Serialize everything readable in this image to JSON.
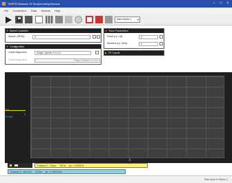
{
  "window": {
    "title": "TM/PS3 Balance Of Reciprocating Masses"
  },
  "menu": [
    "File",
    "Connection",
    "Data",
    "Options",
    "Help"
  ],
  "toolbar": {
    "dataset_select": "Data Series 1"
  },
  "speed_controller": {
    "title": "Speed Controller",
    "speed_label": "Speed: (RPM):",
    "speed_value": "0"
  },
  "configuration": {
    "title": "Configuration",
    "crank_label": "Crank Alignment:",
    "crank_value": "Single Cylinder 0-0-0-0",
    "crank2_label": "Crank Alignment:",
    "crank2_value": "Single Cylinder 0-0-0-0"
  },
  "trace": {
    "title": "Trace Parameters",
    "force_label": "Force p-p: (N):",
    "force_value": "0",
    "moment_label": "Moment p-p: (Nm):",
    "moment_value": "0"
  },
  "dti": {
    "title": "DTI Inputs"
  },
  "plot": {
    "ch1_label": "0 N",
    "ch2_label": "0.0 Nm"
  },
  "channels": [
    {
      "name": "Channel 1 - Force",
      "scale": "100 N",
      "pp": "pk = 0.0000 N"
    },
    {
      "name": "Channel 2 - Moment",
      "scale": "10 Nm",
      "pp": "pk = 0.0000 Nm"
    }
  ],
  "status": {
    "text": "Data Input is Series 1"
  },
  "icons": [
    "play-icon",
    "save-icon",
    "stop-icon",
    "new-doc-icon",
    "chart-icon",
    "circle-icon",
    "delete-icon",
    "settings-icon"
  ],
  "colors": {
    "titlebar": "#2b4fa8",
    "channel1": "#fff27a",
    "channel2": "#7fd6ea"
  }
}
